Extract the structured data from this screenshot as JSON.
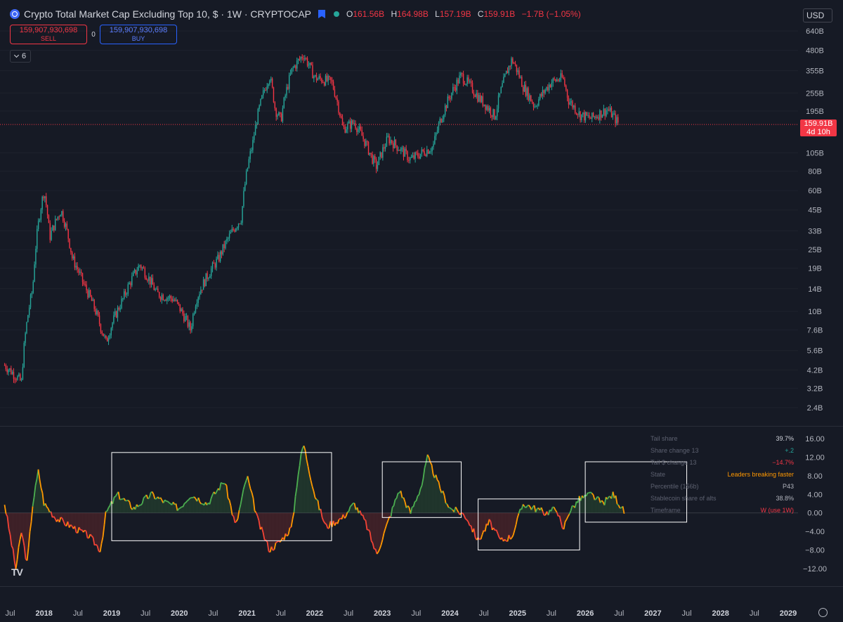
{
  "header": {
    "title": "Crypto Total Market Cap Excluding Top 10, $ · 1W · CRYPTOCAP",
    "ohlc": [
      {
        "k": "O",
        "v": "161.56B"
      },
      {
        "k": "H",
        "v": "164.98B"
      },
      {
        "k": "L",
        "v": "157.19B"
      },
      {
        "k": "C",
        "v": "159.91B"
      }
    ],
    "change": "−1.7B (−1.05%)"
  },
  "trade": {
    "sell_price": "159,907,930,698",
    "sell_label": "SELL",
    "spread": "0",
    "buy_price": "159,907,930,698",
    "buy_label": "BUY"
  },
  "indicators_count": "6",
  "currency": "USD",
  "last_price": {
    "value": "159.91B",
    "countdown": "4d 10h"
  },
  "colors": {
    "bg": "#161a25",
    "up": "#26a69a",
    "down": "#f23645",
    "osc_green": "#4caf50",
    "osc_orange": "#ff9800",
    "osc_red": "#f44336",
    "box": "#ffffff"
  },
  "chart_data": [
    {
      "type": "candlestick",
      "title": "Crypto Total Market Cap Excluding Top 10, $ · 1W · CRYPTOCAP",
      "y_scale": "log",
      "y_ticks": [
        "640B",
        "480B",
        "355B",
        "255B",
        "195B",
        "105B",
        "80B",
        "60B",
        "45B",
        "33B",
        "25B",
        "19B",
        "14B",
        "10B",
        "7.6B",
        "5.6B",
        "4.2B",
        "3.2B",
        "2.4B"
      ],
      "last_value": "159.91B",
      "anchors": [
        {
          "t": "2017-06",
          "v": 4.5
        },
        {
          "t": "2017-09",
          "v": 3.5
        },
        {
          "t": "2017-11",
          "v": 14
        },
        {
          "t": "2018-01",
          "v": 60
        },
        {
          "t": "2018-02",
          "v": 30
        },
        {
          "t": "2018-04",
          "v": 45
        },
        {
          "t": "2018-06",
          "v": 22
        },
        {
          "t": "2018-08",
          "v": 15
        },
        {
          "t": "2018-11",
          "v": 8
        },
        {
          "t": "2018-12",
          "v": 6.3
        },
        {
          "t": "2019-03",
          "v": 12
        },
        {
          "t": "2019-06",
          "v": 20
        },
        {
          "t": "2019-09",
          "v": 13
        },
        {
          "t": "2019-12",
          "v": 12
        },
        {
          "t": "2020-03",
          "v": 7.6
        },
        {
          "t": "2020-04",
          "v": 12
        },
        {
          "t": "2020-08",
          "v": 22
        },
        {
          "t": "2020-12",
          "v": 40
        },
        {
          "t": "2021-02",
          "v": 120
        },
        {
          "t": "2021-05",
          "v": 330
        },
        {
          "t": "2021-06",
          "v": 200
        },
        {
          "t": "2021-07",
          "v": 170
        },
        {
          "t": "2021-09",
          "v": 360
        },
        {
          "t": "2021-11",
          "v": 450
        },
        {
          "t": "2022-01",
          "v": 320
        },
        {
          "t": "2022-04",
          "v": 300
        },
        {
          "t": "2022-06",
          "v": 150
        },
        {
          "t": "2022-08",
          "v": 165
        },
        {
          "t": "2022-11",
          "v": 100
        },
        {
          "t": "2022-12",
          "v": 85
        },
        {
          "t": "2023-02",
          "v": 130
        },
        {
          "t": "2023-06",
          "v": 95
        },
        {
          "t": "2023-09",
          "v": 110
        },
        {
          "t": "2023-10",
          "v": 115
        },
        {
          "t": "2023-12",
          "v": 200
        },
        {
          "t": "2024-03",
          "v": 330
        },
        {
          "t": "2024-06",
          "v": 240
        },
        {
          "t": "2024-09",
          "v": 180
        },
        {
          "t": "2024-12",
          "v": 420
        },
        {
          "t": "2025-02",
          "v": 280
        },
        {
          "t": "2025-04",
          "v": 210
        },
        {
          "t": "2025-07",
          "v": 300
        },
        {
          "t": "2025-09",
          "v": 320
        },
        {
          "t": "2025-10",
          "v": 230
        },
        {
          "t": "2025-12",
          "v": 185
        },
        {
          "t": "2026-02",
          "v": 175
        },
        {
          "t": "2026-05",
          "v": 200
        },
        {
          "t": "2026-07",
          "v": 160
        }
      ]
    },
    {
      "type": "line",
      "y_ticks": [
        "16.00",
        "12.00",
        "8.00",
        "4.00",
        "0.00",
        "−4.00",
        "−8.00",
        "−12.00"
      ],
      "ylim": [
        -14,
        18
      ],
      "series_colors": [
        "#4caf50",
        "#ff9800",
        "#f44336"
      ],
      "anchors": [
        {
          "t": "2017-06",
          "v": 2
        },
        {
          "t": "2017-07",
          "v": -5
        },
        {
          "t": "2017-08",
          "v": -12
        },
        {
          "t": "2017-09",
          "v": -4
        },
        {
          "t": "2017-10",
          "v": -11
        },
        {
          "t": "2017-11",
          "v": 2
        },
        {
          "t": "2017-12",
          "v": 9
        },
        {
          "t": "2018-01",
          "v": 2
        },
        {
          "t": "2018-03",
          "v": -1
        },
        {
          "t": "2018-06",
          "v": -3
        },
        {
          "t": "2018-09",
          "v": -5
        },
        {
          "t": "2018-11",
          "v": -8
        },
        {
          "t": "2018-12",
          "v": 0
        },
        {
          "t": "2019-02",
          "v": 4
        },
        {
          "t": "2019-05",
          "v": 1
        },
        {
          "t": "2019-08",
          "v": 4
        },
        {
          "t": "2019-11",
          "v": 2
        },
        {
          "t": "2020-01",
          "v": 1
        },
        {
          "t": "2020-03",
          "v": 4
        },
        {
          "t": "2020-06",
          "v": 2
        },
        {
          "t": "2020-09",
          "v": 7
        },
        {
          "t": "2020-11",
          "v": -3
        },
        {
          "t": "2021-01",
          "v": 8
        },
        {
          "t": "2021-03",
          "v": -2
        },
        {
          "t": "2021-05",
          "v": -8
        },
        {
          "t": "2021-07",
          "v": -6
        },
        {
          "t": "2021-09",
          "v": -3
        },
        {
          "t": "2021-10",
          "v": 8
        },
        {
          "t": "2021-11",
          "v": 15
        },
        {
          "t": "2022-01",
          "v": 4
        },
        {
          "t": "2022-03",
          "v": -3
        },
        {
          "t": "2022-06",
          "v": -1
        },
        {
          "t": "2022-08",
          "v": 2
        },
        {
          "t": "2022-10",
          "v": -2
        },
        {
          "t": "2022-12",
          "v": -9
        },
        {
          "t": "2023-02",
          "v": -2
        },
        {
          "t": "2023-04",
          "v": 5
        },
        {
          "t": "2023-06",
          "v": 0
        },
        {
          "t": "2023-08",
          "v": 6
        },
        {
          "t": "2023-09",
          "v": 12
        },
        {
          "t": "2023-11",
          "v": 6
        },
        {
          "t": "2024-01",
          "v": 1
        },
        {
          "t": "2024-03",
          "v": 0
        },
        {
          "t": "2024-04",
          "v": -1
        },
        {
          "t": "2024-06",
          "v": -6
        },
        {
          "t": "2024-08",
          "v": -2
        },
        {
          "t": "2024-10",
          "v": -6
        },
        {
          "t": "2024-12",
          "v": -5
        },
        {
          "t": "2025-02",
          "v": 2
        },
        {
          "t": "2025-04",
          "v": 1
        },
        {
          "t": "2025-06",
          "v": 0
        },
        {
          "t": "2025-08",
          "v": 1
        },
        {
          "t": "2025-09",
          "v": -4
        },
        {
          "t": "2025-10",
          "v": 0
        },
        {
          "t": "2025-12",
          "v": 3
        },
        {
          "t": "2026-02",
          "v": 4
        },
        {
          "t": "2026-04",
          "v": 2
        },
        {
          "t": "2026-06",
          "v": 4
        },
        {
          "t": "2026-08",
          "v": 0
        }
      ],
      "highlight_boxes": [
        {
          "from": "2019-01",
          "to": "2022-04",
          "ymin": -6,
          "ymax": 13
        },
        {
          "from": "2023-01",
          "to": "2024-03",
          "ymin": -1,
          "ymax": 11
        },
        {
          "from": "2024-06",
          "to": "2025-12",
          "ymin": -8,
          "ymax": 3
        },
        {
          "from": "2026-01",
          "to": "2027-07",
          "ymin": -2,
          "ymax": 11
        }
      ],
      "table": [
        {
          "k": "Tail share",
          "v": "39.7%",
          "color": "#d1d4dc"
        },
        {
          "k": "Share change 13",
          "v": "+.2",
          "color": "#26a69a"
        },
        {
          "k": "Tail $ change 13",
          "v": "−14.7%",
          "color": "#f23645"
        },
        {
          "k": "State",
          "v": "Leaders breaking faster",
          "color": "#ff9800"
        },
        {
          "k": "Percentile (156b)",
          "v": "P43",
          "color": "#b2b5be"
        },
        {
          "k": "Stablecoin share of alts",
          "v": "38.8%",
          "color": "#b2b5be"
        },
        {
          "k": "Timeframe",
          "v": "W (use 1W)",
          "color": "#f23645"
        }
      ]
    }
  ],
  "time_axis": [
    {
      "label": "Jul",
      "t": "2017-07",
      "year": false
    },
    {
      "label": "2018",
      "t": "2018-01",
      "year": true
    },
    {
      "label": "Jul",
      "t": "2018-07",
      "year": false
    },
    {
      "label": "2019",
      "t": "2019-01",
      "year": true
    },
    {
      "label": "Jul",
      "t": "2019-07",
      "year": false
    },
    {
      "label": "2020",
      "t": "2020-01",
      "year": true
    },
    {
      "label": "Jul",
      "t": "2020-07",
      "year": false
    },
    {
      "label": "2021",
      "t": "2021-01",
      "year": true
    },
    {
      "label": "Jul",
      "t": "2021-07",
      "year": false
    },
    {
      "label": "2022",
      "t": "2022-01",
      "year": true
    },
    {
      "label": "Jul",
      "t": "2022-07",
      "year": false
    },
    {
      "label": "2023",
      "t": "2023-01",
      "year": true
    },
    {
      "label": "Jul",
      "t": "2023-07",
      "year": false
    },
    {
      "label": "2024",
      "t": "2024-01",
      "year": true
    },
    {
      "label": "Jul",
      "t": "2024-07",
      "year": false
    },
    {
      "label": "2025",
      "t": "2025-01",
      "year": true
    },
    {
      "label": "Jul",
      "t": "2025-07",
      "year": false
    },
    {
      "label": "2026",
      "t": "2026-01",
      "year": true
    },
    {
      "label": "Jul",
      "t": "2026-07",
      "year": false
    },
    {
      "label": "2027",
      "t": "2027-01",
      "year": true
    },
    {
      "label": "Jul",
      "t": "2027-07",
      "year": false
    },
    {
      "label": "2028",
      "t": "2028-01",
      "year": true
    },
    {
      "label": "Jul",
      "t": "2028-07",
      "year": false
    },
    {
      "label": "2029",
      "t": "2029-01",
      "year": true
    }
  ]
}
